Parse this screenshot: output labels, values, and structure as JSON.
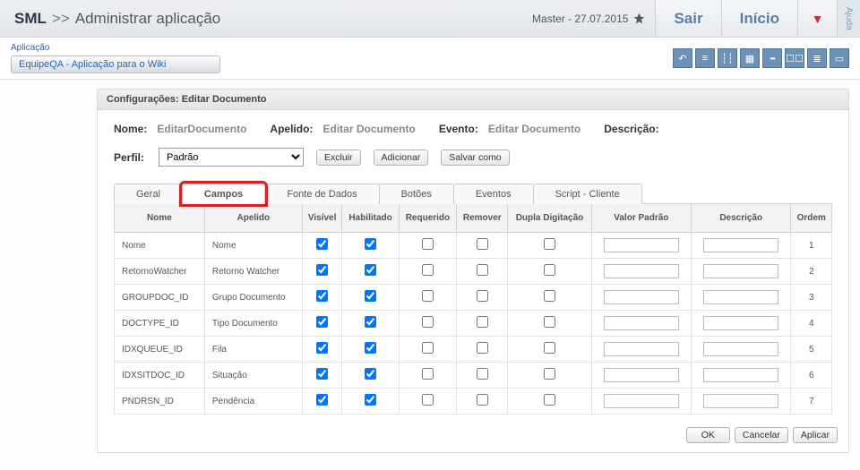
{
  "header": {
    "brand": "SML",
    "sep": ">>",
    "page": "Administrar aplicação",
    "user": "Master - 27.07.2015",
    "logout": "Sair",
    "home": "Início",
    "dropdown_glyph": "▼",
    "help": "Ajuda"
  },
  "appbar": {
    "label": "Aplicação",
    "appname": "EquipeQA - Aplicação para o Wiki"
  },
  "toolbar_icons": [
    {
      "name": "undo-icon",
      "glyph": "↶"
    },
    {
      "name": "list-icon",
      "glyph": "≡"
    },
    {
      "name": "sliders-icon",
      "glyph": "┆┆"
    },
    {
      "name": "grid-icon",
      "glyph": "▦"
    },
    {
      "name": "status-icon",
      "glyph": "•••"
    },
    {
      "name": "layout-icon",
      "glyph": "☐☐"
    },
    {
      "name": "rows-icon",
      "glyph": "≣"
    },
    {
      "name": "label-icon",
      "glyph": "▭"
    }
  ],
  "panel": {
    "title": "Configurações: Editar Documento",
    "nome_lbl": "Nome:",
    "nome_val": "EditarDocumento",
    "apelido_lbl": "Apelido:",
    "apelido_val": "Editar Documento",
    "evento_lbl": "Evento:",
    "evento_val": "Editar Documento",
    "descricao_lbl": "Descrição:",
    "perfil_lbl": "Perfil:",
    "perfil_val": "Padrão",
    "btn_excluir": "Excluir",
    "btn_adicionar": "Adicionar",
    "btn_salvarcomo": "Salvar como"
  },
  "tabs": [
    "Geral",
    "Campos",
    "Fonte de Dados",
    "Botões",
    "Eventos",
    "Script - Cliente"
  ],
  "active_tab": 1,
  "table": {
    "headers": [
      "Nome",
      "Apelido",
      "Visível",
      "Habilitado",
      "Requerido",
      "Remover",
      "Dupla Digitação",
      "Valor Padrão",
      "Descrição",
      "Ordem"
    ],
    "rows": [
      {
        "nome": "Nome",
        "apelido": "Nome",
        "vis": true,
        "hab": true,
        "req": false,
        "rem": false,
        "dup": false,
        "valor": "",
        "desc": "",
        "ordem": "1"
      },
      {
        "nome": "RetornoWatcher",
        "apelido": "Retorno Watcher",
        "vis": true,
        "hab": true,
        "req": false,
        "rem": false,
        "dup": false,
        "valor": "",
        "desc": "",
        "ordem": "2"
      },
      {
        "nome": "GROUPDOC_ID",
        "apelido": "Grupo Documento",
        "vis": true,
        "hab": true,
        "req": false,
        "rem": false,
        "dup": false,
        "valor": "",
        "desc": "",
        "ordem": "3"
      },
      {
        "nome": "DOCTYPE_ID",
        "apelido": "Tipo Documento",
        "vis": true,
        "hab": true,
        "req": false,
        "rem": false,
        "dup": false,
        "valor": "",
        "desc": "",
        "ordem": "4"
      },
      {
        "nome": "IDXQUEUE_ID",
        "apelido": "Fila",
        "vis": true,
        "hab": true,
        "req": false,
        "rem": false,
        "dup": false,
        "valor": "",
        "desc": "",
        "ordem": "5"
      },
      {
        "nome": "IDXSITDOC_ID",
        "apelido": "Situação",
        "vis": true,
        "hab": true,
        "req": false,
        "rem": false,
        "dup": false,
        "valor": "",
        "desc": "",
        "ordem": "6"
      },
      {
        "nome": "PNDRSN_ID",
        "apelido": "Pendência",
        "vis": true,
        "hab": true,
        "req": false,
        "rem": false,
        "dup": false,
        "valor": "",
        "desc": "",
        "ordem": "7"
      }
    ]
  },
  "footer": {
    "ok": "OK",
    "cancel": "Cancelar",
    "apply": "Aplicar"
  }
}
